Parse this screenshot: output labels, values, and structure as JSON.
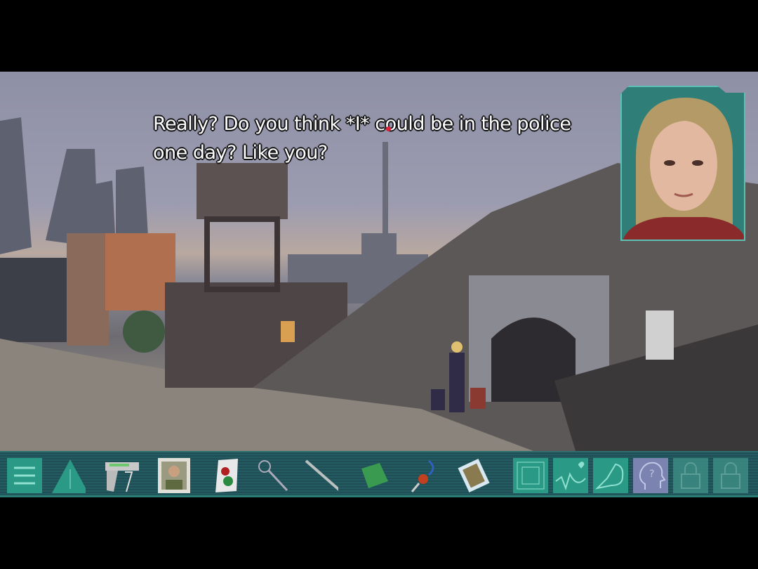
{
  "dialogue": {
    "text": "Really? Do you think *I* could be in the police one day? Like you?"
  },
  "speaker": {
    "portrait": "blonde-girl-portrait"
  },
  "toolbar": {
    "menu": "menu-icon",
    "inventory": [
      {
        "name": "pistol-icon"
      },
      {
        "name": "photo-man-icon"
      },
      {
        "name": "playing-card-icon"
      },
      {
        "name": "key-icon"
      },
      {
        "name": "scalpel-icon"
      },
      {
        "name": "green-book-icon"
      },
      {
        "name": "keychain-icon"
      },
      {
        "name": "framed-photo-icon"
      }
    ],
    "abilities": [
      {
        "name": "chip-icon",
        "state": "active"
      },
      {
        "name": "heartbeat-icon",
        "state": "active"
      },
      {
        "name": "strength-arm-icon",
        "state": "active"
      },
      {
        "name": "mind-question-icon",
        "state": "selected"
      },
      {
        "name": "lock-icon",
        "state": "locked"
      },
      {
        "name": "lock-icon",
        "state": "locked"
      }
    ]
  },
  "colors": {
    "toolbar": "#245a61",
    "accent": "#2a9a86",
    "selected": "#7b83b0",
    "cursor": "#e0203a"
  }
}
